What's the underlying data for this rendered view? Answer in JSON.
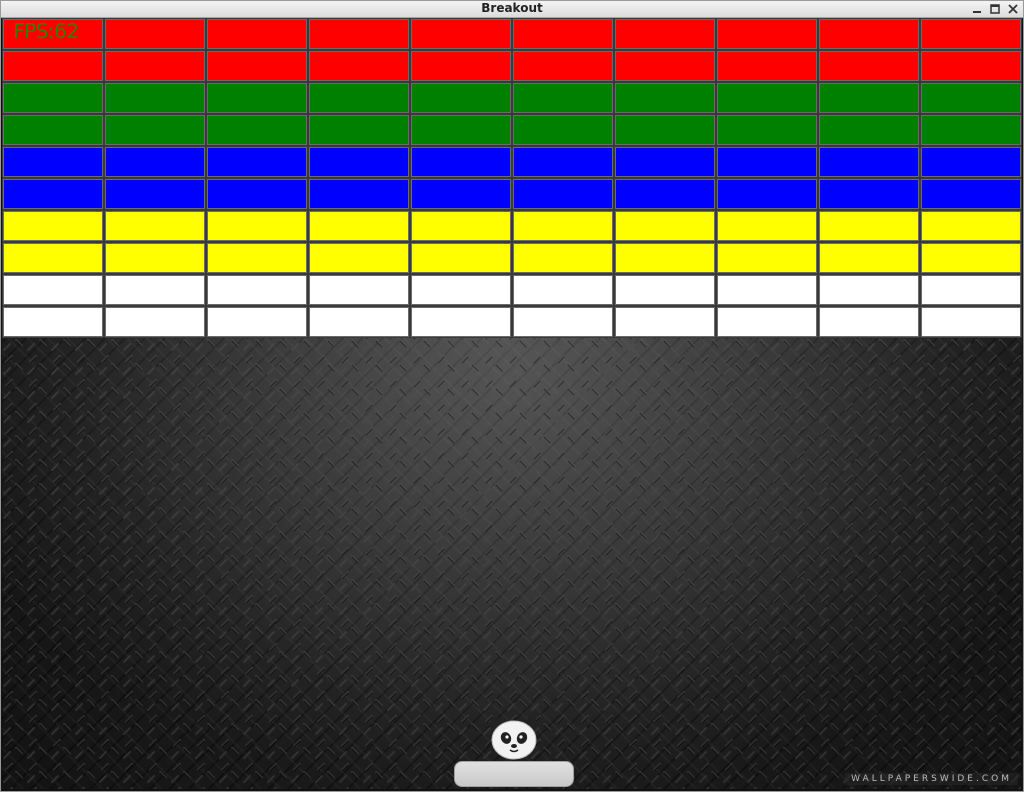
{
  "window": {
    "title": "Breakout",
    "controls": [
      "minimize-icon",
      "maximize-icon",
      "close-icon"
    ]
  },
  "hud": {
    "fps_label": "FPS:62"
  },
  "bricks": {
    "columns": 10,
    "rows": [
      {
        "color": "#ff0000",
        "name": "red"
      },
      {
        "color": "#ff0000",
        "name": "red"
      },
      {
        "color": "#008000",
        "name": "green"
      },
      {
        "color": "#008000",
        "name": "green"
      },
      {
        "color": "#0000ff",
        "name": "blue"
      },
      {
        "color": "#0000ff",
        "name": "blue"
      },
      {
        "color": "#ffff00",
        "name": "yellow"
      },
      {
        "color": "#ffff00",
        "name": "yellow"
      },
      {
        "color": "#ffffff",
        "name": "white"
      },
      {
        "color": "#ffffff",
        "name": "white"
      }
    ]
  },
  "ball": {
    "icon": "panda-icon"
  },
  "paddle": {
    "color": "#d4d4d4"
  },
  "background": {
    "watermark": "WALLPAPERSWIDE.COM"
  }
}
